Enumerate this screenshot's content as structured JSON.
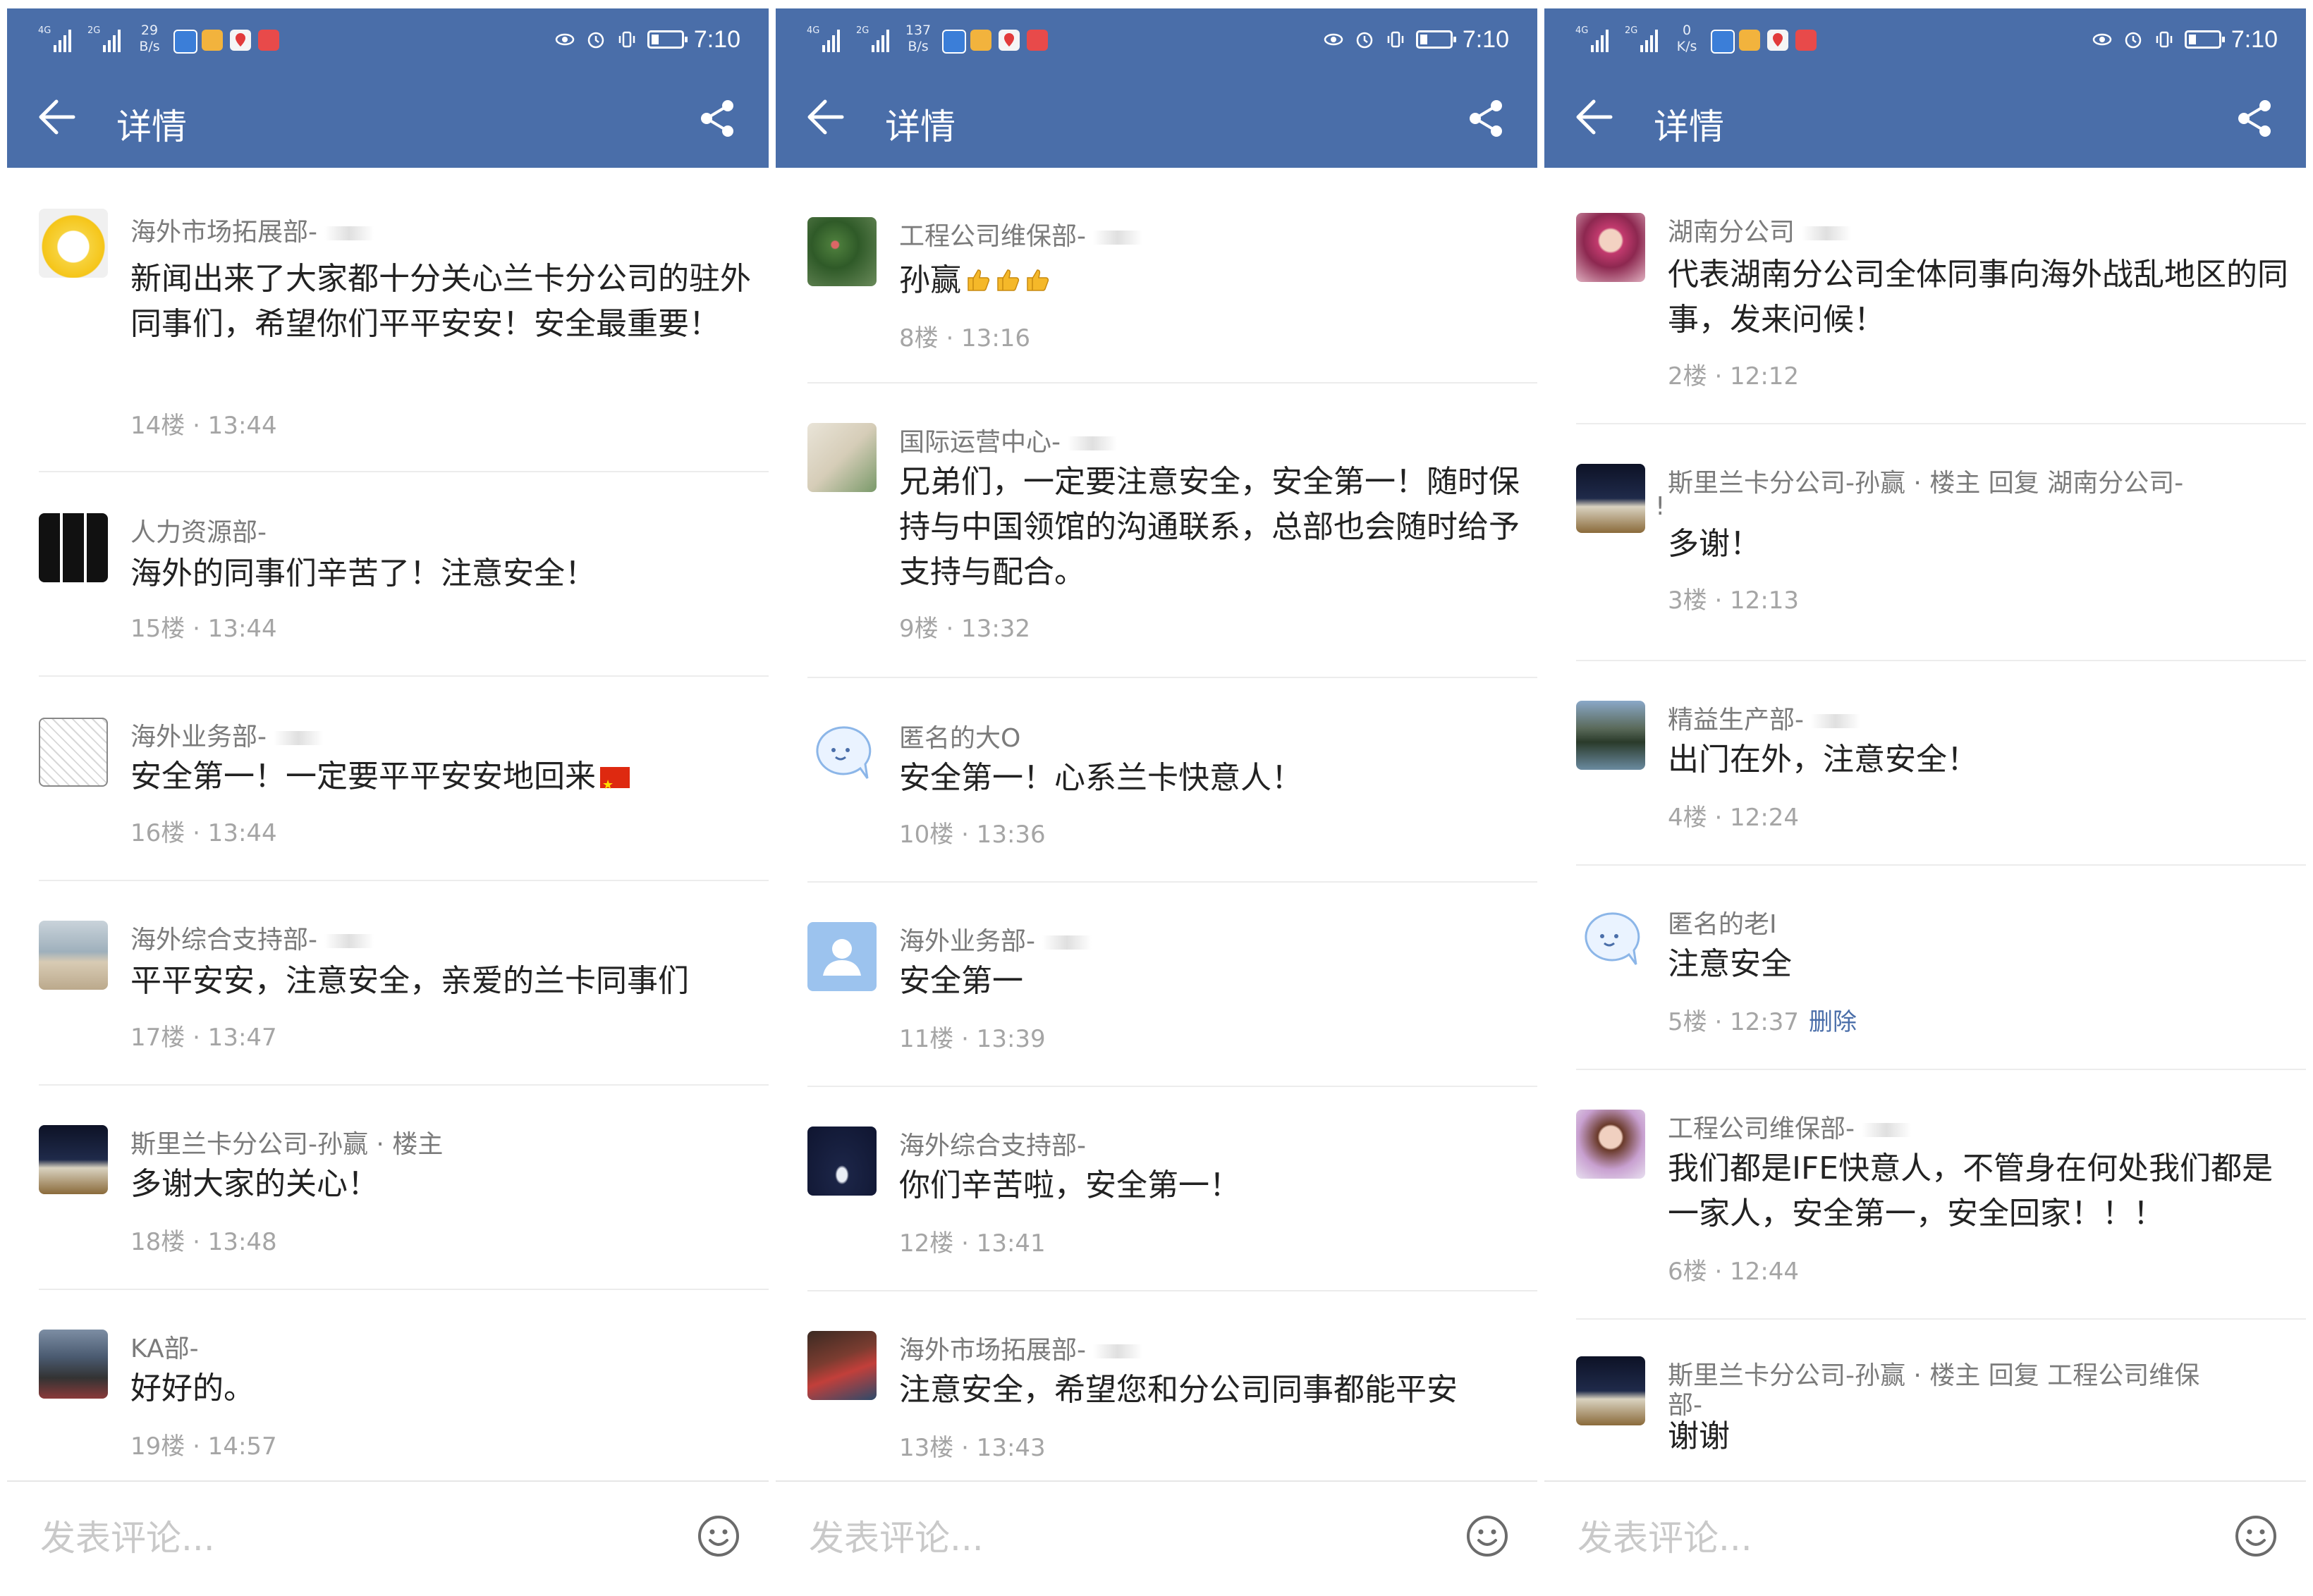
{
  "colors": {
    "accent": "#4a6ea9",
    "delete": "#4a6ea9"
  },
  "panels": [
    {
      "status": {
        "speed_top": "29",
        "speed_unit": "B/s",
        "time": "7:10",
        "net1": "4G",
        "net2": "2G"
      },
      "header": {
        "title": "详情",
        "back_icon": "arrow-left-icon",
        "share_icon": "share-icon"
      },
      "comments": [
        {
          "name": "海外市场拓展部-",
          "text": "新闻出来了大家都十分关心兰卡分公司的驻外同事们，希望你们平平安安！安全最重要！",
          "meta": "14楼 · 13:44",
          "avatar": "cat-flower"
        },
        {
          "name": "人力资源部-",
          "text": "海外的同事们辛苦了！注意安全！",
          "meta": "15楼 · 13:44",
          "avatar": "icons-grid"
        },
        {
          "name": "海外业务部-",
          "text": "安全第一！一定要平平安安地回来",
          "meta": "16楼 · 13:44",
          "avatar": "comic"
        },
        {
          "name": "海外综合支持部-",
          "text": "平平安安，注意安全，亲爱的兰卡同事们",
          "meta": "17楼 · 13:47",
          "avatar": "beach"
        },
        {
          "name": "斯里兰卡分公司-孙赢 · 楼主",
          "text": "多谢大家的关心！",
          "meta": "18楼 · 13:48",
          "avatar": "building-night"
        },
        {
          "name": "KA部-",
          "text": "好好的。",
          "meta": "19楼 · 14:57",
          "avatar": "street"
        }
      ],
      "input": {
        "placeholder": "发表评论..."
      }
    },
    {
      "status": {
        "speed_top": "137",
        "speed_unit": "B/s",
        "time": "7:10",
        "net1": "4G",
        "net2": "2G"
      },
      "header": {
        "title": "详情",
        "back_icon": "arrow-left-icon",
        "share_icon": "share-icon"
      },
      "comments": [
        {
          "name": "工程公司维保部-",
          "text": "孙赢",
          "meta": "8楼 · 13:16",
          "avatar": "flowers"
        },
        {
          "name": "国际运营中心-",
          "text": "兄弟们，一定要注意安全，安全第一！随时保持与中国领馆的沟通联系，总部也会随时给予支持与配合。",
          "meta": "9楼 · 13:32",
          "avatar": "cup"
        },
        {
          "name": "匿名的大O",
          "text": "安全第一！心系兰卡快意人！",
          "meta": "10楼 · 13:36",
          "avatar": "anon-bubble"
        },
        {
          "name": "海外业务部-",
          "text": "安全第一",
          "meta": "11楼 · 13:39",
          "avatar": "default-user"
        },
        {
          "name": "海外综合支持部-",
          "text": "你们辛苦啦，安全第一！",
          "meta": "12楼 · 13:41",
          "avatar": "whale"
        },
        {
          "name": "海外市场拓展部-",
          "text": "注意安全，希望您和分公司同事都能平安",
          "meta": "13楼 · 13:43",
          "avatar": "dancer"
        }
      ],
      "input": {
        "placeholder": "发表评论..."
      }
    },
    {
      "status": {
        "speed_top": "0",
        "speed_unit": "K/s",
        "time": "7:10",
        "net1": "4G",
        "net2": "2G"
      },
      "header": {
        "title": "详情",
        "back_icon": "arrow-left-icon",
        "share_icon": "share-icon"
      },
      "comments": [
        {
          "name": "湖南分公司",
          "text": "代表湖南分公司全体同事向海外战乱地区的同事，发来问候！",
          "meta": "2楼 · 12:12",
          "avatar": "girl"
        },
        {
          "name": "斯里兰卡分公司-孙赢 · 楼主 回复 湖南分公司-",
          "name2": "!",
          "text": "多谢！",
          "meta": "3楼 · 12:13",
          "avatar": "building-night"
        },
        {
          "name": "精益生产部-",
          "text": "出门在外，注意安全！",
          "meta": "4楼 · 12:24",
          "avatar": "water-town"
        },
        {
          "name": "匿名的老I",
          "text": "注意安全",
          "meta": "5楼 · 12:37",
          "delete": "删除",
          "avatar": "anon-bubble"
        },
        {
          "name": "工程公司维保部-",
          "text": "我们都是IFE快意人，不管身在何处我们都是一家人，安全第一，安全回家！！！",
          "meta": "6楼 · 12:44",
          "avatar": "woman"
        },
        {
          "name": "斯里兰卡分公司-孙赢 · 楼主 回复 工程公司维保",
          "name2": "部-",
          "text": "谢谢",
          "meta": "",
          "avatar": "building-night"
        }
      ],
      "input": {
        "placeholder": "发表评论..."
      }
    }
  ]
}
